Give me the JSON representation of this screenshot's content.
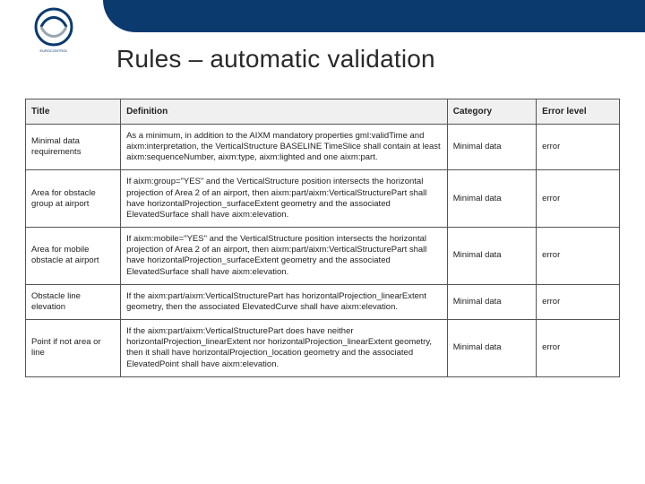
{
  "brand": {
    "name": "EUROCONTROL",
    "band_color": "#0b3a6f"
  },
  "title": "Rules – automatic validation",
  "table": {
    "columns": [
      "Title",
      "Definition",
      "Category",
      "Error level"
    ],
    "rows": [
      {
        "title": "Minimal data requirements",
        "definition": "As a minimum, in addition to the AIXM mandatory properties gml:validTime and aixm:interpretation, the VerticalStructure BASELINE TimeSlice shall contain at least aixm:sequenceNumber, aixm:type, aixm:lighted and one aixm:part.",
        "category": "Minimal data",
        "error": "error"
      },
      {
        "title": "Area for obstacle group at airport",
        "definition": "If aixm:group=\"YES\" and the VerticalStructure position intersects the horizontal projection of Area 2 of an airport, then aixm:part/aixm:VerticalStructurePart shall have horizontalProjection_surfaceExtent geometry and the associated ElevatedSurface shall have aixm:elevation.",
        "category": "Minimal data",
        "error": "error"
      },
      {
        "title": "Area for mobile obstacle at airport",
        "definition": "If aixm:mobile=\"YES\" and the VerticalStructure position intersects the horizontal projection of Area 2 of an airport, then aixm:part/aixm:VerticalStructurePart shall have horizontalProjection_surfaceExtent geometry and the associated ElevatedSurface shall have aixm:elevation.",
        "category": "Minimal data",
        "error": "error"
      },
      {
        "title": "Obstacle line elevation",
        "definition": "If the aixm:part/aixm:VerticalStructurePart has horizontalProjection_linearExtent geometry, then the associated ElevatedCurve shall have aixm:elevation.",
        "category": "Minimal data",
        "error": "error"
      },
      {
        "title": "Point if not area or line",
        "definition": "If the aixm:part/aixm:VerticalStructurePart does have neither horizontalProjection_linearExtent nor horizontalProjection_linearExtent geometry, then it shall have horizontalProjection_location geometry and the associated ElevatedPoint shall have aixm:elevation.",
        "category": "Minimal data",
        "error": "error"
      }
    ]
  }
}
